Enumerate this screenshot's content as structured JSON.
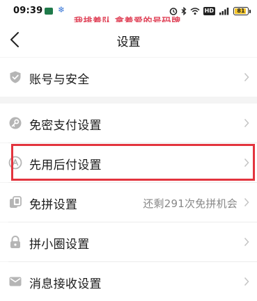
{
  "status_bar": {
    "time": "09:39",
    "battery": "81",
    "network_badge": "HD",
    "signal_text": "4G"
  },
  "watermark": "我排着队 拿着爱的号码牌",
  "header": {
    "title": "设置"
  },
  "settings": {
    "items": [
      {
        "label": "账号与安全",
        "value": "",
        "icon": "shield-icon"
      },
      {
        "label": "免密支付设置",
        "value": "",
        "icon": "key-icon"
      },
      {
        "label": "先用后付设置",
        "value": "",
        "icon": "pay-later-icon"
      },
      {
        "label": "免拼设置",
        "value": "还剩291次免拼机会",
        "icon": "group-copy-icon"
      },
      {
        "label": "拼小圈设置",
        "value": "",
        "icon": "lock-icon"
      },
      {
        "label": "消息接收设置",
        "value": "",
        "icon": "mail-icon"
      }
    ]
  },
  "colors": {
    "highlight": "#e3343e",
    "watermark": "#e0455a",
    "icon": "#b5b5b5",
    "background": "#f4f4f4"
  }
}
